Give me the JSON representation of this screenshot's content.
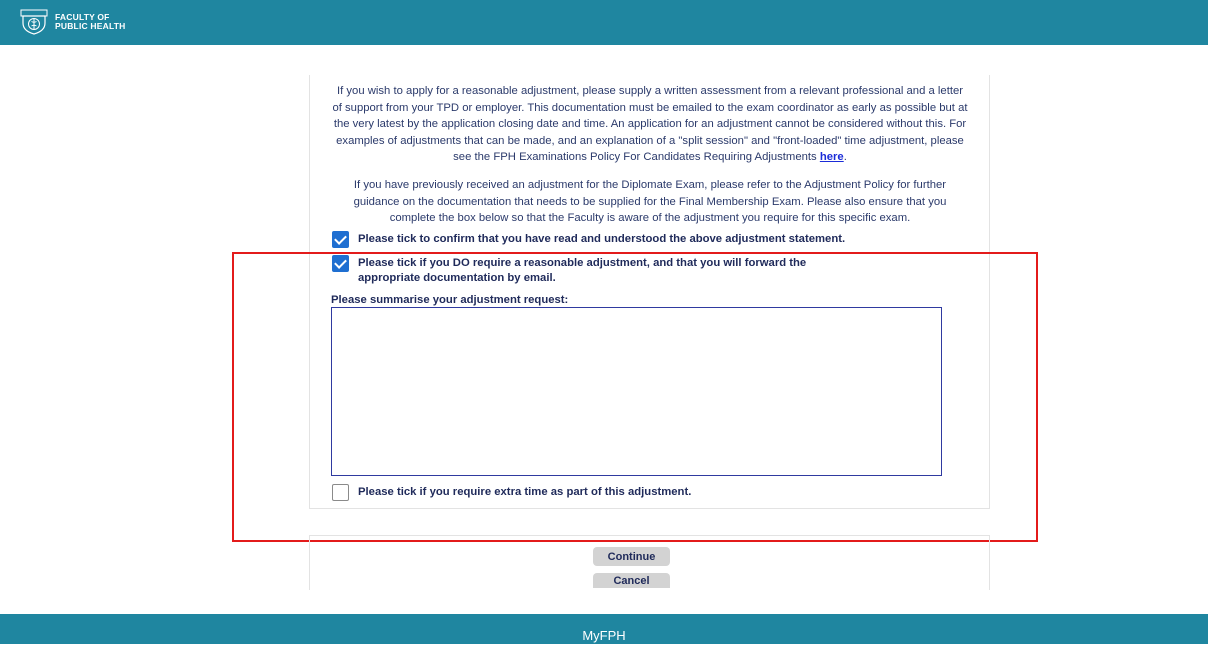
{
  "header": {
    "logo_line1": "FACULTY OF",
    "logo_line2": "PUBLIC HEALTH",
    "logo_icon": "fph-crest-icon",
    "background_color": "#1f86a0"
  },
  "adjustment": {
    "paragraph1": "If you wish to apply for a reasonable adjustment, please supply a written assessment from a relevant professional and a letter of support from your TPD or employer. This documentation must be emailed to the exam coordinator as early as possible but at the very latest by the application closing date and time. An application for an adjustment cannot be considered without this. For examples of adjustments that can be made, and an explanation of a \"split session\" and \"front-loaded\" time adjustment, please see the FPH Examinations Policy For Candidates Requiring Adjustments ",
    "paragraph1_link": "here",
    "paragraph1_end": ".",
    "paragraph2": "If you have previously received an adjustment for the Diplomate Exam, please refer to the Adjustment Policy for further guidance on the documentation that needs to be supplied for the Final Membership Exam. Please also ensure that you complete the box below so that the Faculty is aware of the adjustment you require for this specific exam.",
    "checkboxes": [
      {
        "label": "Please tick to confirm that you have read and understood the above adjustment statement.",
        "checked": true
      },
      {
        "label": "Please tick if you DO require a reasonable adjustment, and that you will forward the appropriate documentation by email.",
        "checked": true
      },
      {
        "label": "Please tick if you require extra time as part of this adjustment.",
        "checked": false
      }
    ],
    "summary_label": "Please summarise your adjustment request:",
    "summary_value": ""
  },
  "actions": {
    "continue_label": "Continue",
    "cancel_label": "Cancel"
  },
  "footer": {
    "text": "MyFPH"
  },
  "colors": {
    "checkbox_checked": "#1f6fd1",
    "highlight": "#e31b1b"
  }
}
